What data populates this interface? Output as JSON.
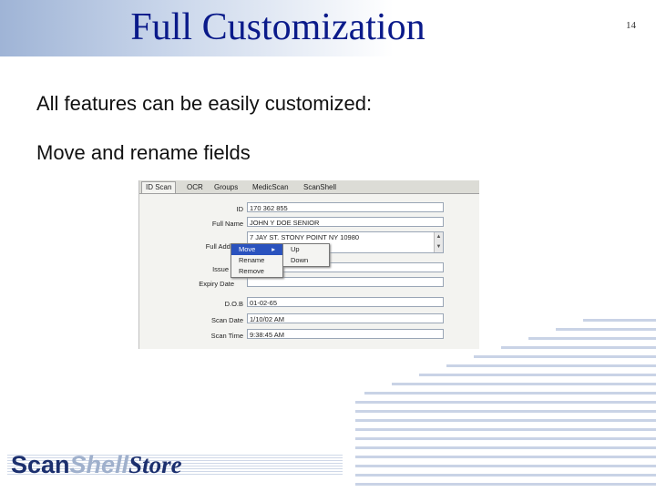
{
  "slide": {
    "title": "Full Customization",
    "page_number": "14",
    "bullet1": "All features can be easily customized:",
    "bullet2": "Move and rename fields"
  },
  "app": {
    "tabs": [
      "ID Scan",
      "OCR",
      "Groups",
      "MedicScan",
      "ScanShell"
    ],
    "fields": [
      {
        "label": "ID",
        "value": "170 362 855"
      },
      {
        "label": "Full Name",
        "value": "JOHN Y DOE SENIOR"
      },
      {
        "label": "Full Address",
        "value": "7 JAY ST. STONY POINT NY 10980"
      },
      {
        "label": "Issue",
        "value": ""
      },
      {
        "label": "Expiry Date",
        "value": ""
      },
      {
        "label": "D.O.B",
        "value": "01-02-65"
      },
      {
        "label": "Scan Date",
        "value": "1/10/02 AM"
      },
      {
        "label": "Scan Time",
        "value": "9:38:45 AM"
      }
    ],
    "context_menu": [
      "Move",
      "Rename",
      "Remove"
    ],
    "submenu": [
      "Up",
      "Down"
    ]
  },
  "logo": {
    "part1": "Scan",
    "part2": "Shell",
    "part3": "Store"
  },
  "colors": {
    "title": "#0a1a8a",
    "menu_highlight": "#2a52be",
    "logo_dark": "#1b2f6e"
  }
}
